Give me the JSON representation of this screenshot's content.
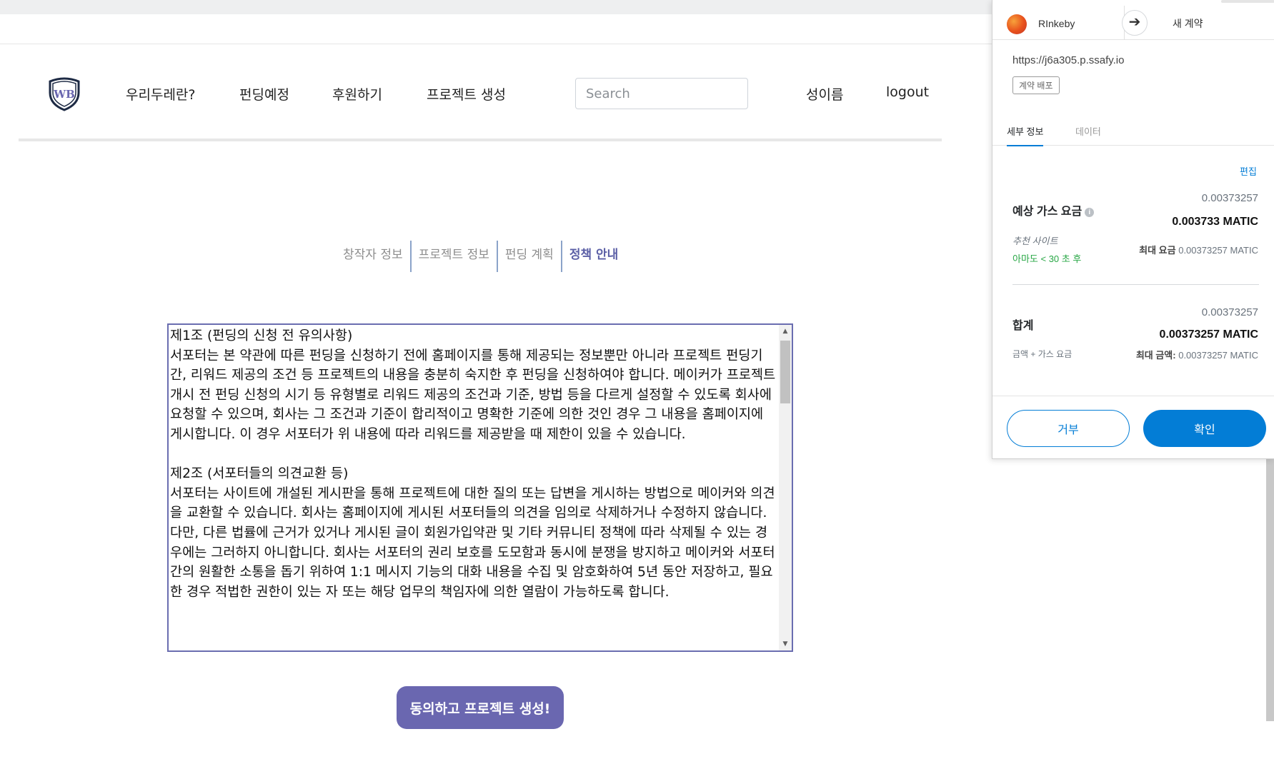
{
  "nav": {
    "items": [
      "우리두레란?",
      "펀딩예정",
      "후원하기",
      "프로젝트 생성"
    ],
    "search_placeholder": "Search",
    "user_name": "성이름",
    "logout_label": "logout"
  },
  "steps": {
    "items": [
      "창작자 정보",
      "프로젝트 정보",
      "펀딩 계획",
      "정책 안내"
    ],
    "active_index": 3
  },
  "terms": {
    "text": "제1조 (펀딩의 신청 전 유의사항)\n서포터는 본 약관에 따른 펀딩을 신청하기 전에 홈페이지를 통해 제공되는 정보뿐만 아니라 프로젝트 펀딩기간, 리워드 제공의 조건 등 프로젝트의 내용을 충분히 숙지한 후 펀딩을 신청하여야 합니다. 메이커가 프로젝트 개시 전 펀딩 신청의 시기 등 유형별로 리워드 제공의 조건과 기준, 방법 등을 다르게 설정할 수 있도록 회사에 요청할 수 있으며, 회사는 그 조건과 기준이 합리적이고 명확한 기준에 의한 것인 경우 그 내용을 홈페이지에 게시합니다. 이 경우 서포터가 위 내용에 따라 리워드를 제공받을 때 제한이 있을 수 있습니다.\n\n제2조 (서포터들의 의견교환 등)\n서포터는 사이트에 개설된 게시판을 통해 프로젝트에 대한 질의 또는 답변을 게시하는 방법으로 메이커와 의견을 교환할 수 있습니다. 회사는 홈페이지에 게시된 서포터들의 의견을 임의로 삭제하거나 수정하지 않습니다. 다만, 다른 법률에 근거가 있거나 게시된 글이 회원가입약관 및 기타 커뮤니티 정책에 따라 삭제될 수 있는 경우에는 그러하지 아니합니다. 회사는 서포터의 권리 보호를 도모함과 동시에 분쟁을 방지하고 메이커와 서포터 간의 원활한 소통을 돕기 위하여 1:1 메시지 기능의 대화 내용을 수집 및 암호화하여 5년 동안 저장하고, 필요한 경우 적법한 권한이 있는 자 또는 해당 업무의 책임자에 의한 열람이 가능하도록 합니다."
  },
  "agree_button_label": "동의하고 프로젝트 생성!",
  "popup": {
    "network": "RInkeby",
    "target": "새 계약",
    "origin": "https://j6a305.p.ssafy.io",
    "badge": "계약 배포",
    "tabs": [
      "세부 정보",
      "데이터"
    ],
    "edit_label": "편집",
    "gas_label": "예상 가스 요금",
    "gas_fiat": "0.00373257",
    "gas_native": "0.003733 MATIC",
    "suggested_site": "추천 사이트",
    "speed_text": "아마도 < 30 초 후",
    "max_fee_label": "최대 요금",
    "max_fee_value": "0.00373257 MATIC",
    "total_label": "합계",
    "total_fiat": "0.00373257",
    "total_native": "0.00373257 MATIC",
    "total_sub": "금액 + 가스 요금",
    "total_max_label": "최대 금액:",
    "total_max_value": "0.00373257 MATIC",
    "reject_label": "거부",
    "confirm_label": "확인"
  },
  "colors": {
    "accent_purple": "#6a67b0",
    "metamask_blue": "#037dd6",
    "speed_green": "#28a745"
  }
}
